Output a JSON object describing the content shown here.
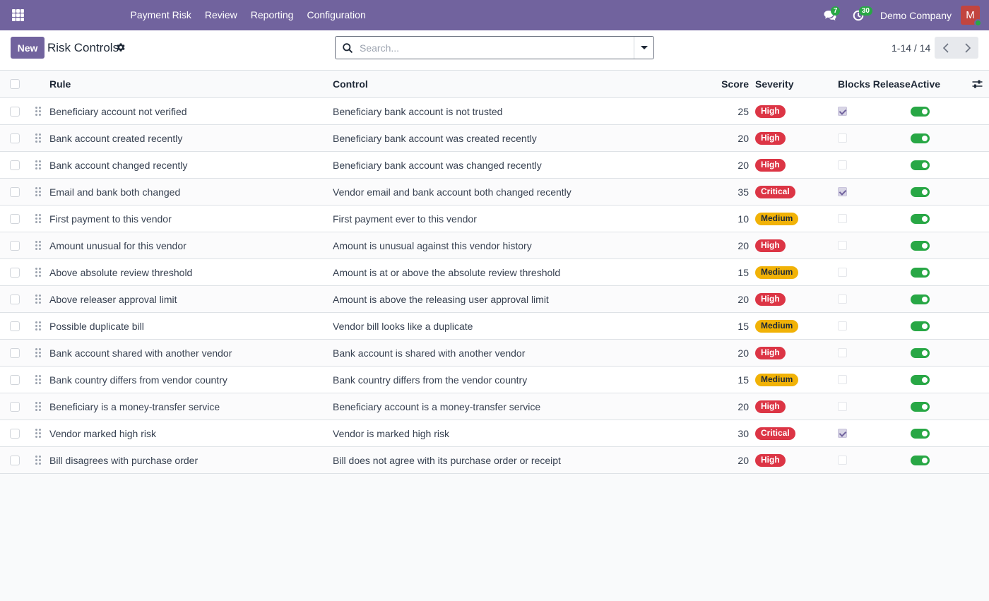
{
  "nav": {
    "menu": [
      "Payment Risk",
      "Review",
      "Reporting",
      "Configuration"
    ],
    "messages_count": "7",
    "activities_count": "30",
    "company": "Demo Company",
    "avatar_letter": "M",
    "brand_color": "#71639e"
  },
  "control_panel": {
    "new_label": "New",
    "title": "Risk Controls",
    "search_placeholder": "Search...",
    "pager": "1-14 / 14"
  },
  "table": {
    "columns": {
      "rule": "Rule",
      "control": "Control",
      "score": "Score",
      "severity": "Severity",
      "blocks_release": "Blocks Release",
      "active": "Active"
    },
    "severity_colors": {
      "High": "#dc3545",
      "Critical": "#dc3545",
      "Medium": "#f1b207"
    },
    "rows": [
      {
        "rule": "Beneficiary account not verified",
        "control": "Beneficiary bank account is not trusted",
        "score": "25",
        "severity": "High",
        "blocks_release": true,
        "active": true
      },
      {
        "rule": "Bank account created recently",
        "control": "Beneficiary bank account was created recently",
        "score": "20",
        "severity": "High",
        "blocks_release": false,
        "active": true
      },
      {
        "rule": "Bank account changed recently",
        "control": "Beneficiary bank account was changed recently",
        "score": "20",
        "severity": "High",
        "blocks_release": false,
        "active": true
      },
      {
        "rule": "Email and bank both changed",
        "control": "Vendor email and bank account both changed recently",
        "score": "35",
        "severity": "Critical",
        "blocks_release": true,
        "active": true
      },
      {
        "rule": "First payment to this vendor",
        "control": "First payment ever to this vendor",
        "score": "10",
        "severity": "Medium",
        "blocks_release": false,
        "active": true
      },
      {
        "rule": "Amount unusual for this vendor",
        "control": "Amount is unusual against this vendor history",
        "score": "20",
        "severity": "High",
        "blocks_release": false,
        "active": true
      },
      {
        "rule": "Above absolute review threshold",
        "control": "Amount is at or above the absolute review threshold",
        "score": "15",
        "severity": "Medium",
        "blocks_release": false,
        "active": true
      },
      {
        "rule": "Above releaser approval limit",
        "control": "Amount is above the releasing user approval limit",
        "score": "20",
        "severity": "High",
        "blocks_release": false,
        "active": true
      },
      {
        "rule": "Possible duplicate bill",
        "control": "Vendor bill looks like a duplicate",
        "score": "15",
        "severity": "Medium",
        "blocks_release": false,
        "active": true
      },
      {
        "rule": "Bank account shared with another vendor",
        "control": "Bank account is shared with another vendor",
        "score": "20",
        "severity": "High",
        "blocks_release": false,
        "active": true
      },
      {
        "rule": "Bank country differs from vendor country",
        "control": "Bank country differs from the vendor country",
        "score": "15",
        "severity": "Medium",
        "blocks_release": false,
        "active": true
      },
      {
        "rule": "Beneficiary is a money-transfer service",
        "control": "Beneficiary account is a money-transfer service",
        "score": "20",
        "severity": "High",
        "blocks_release": false,
        "active": true
      },
      {
        "rule": "Vendor marked high risk",
        "control": "Vendor is marked high risk",
        "score": "30",
        "severity": "Critical",
        "blocks_release": true,
        "active": true
      },
      {
        "rule": "Bill disagrees with purchase order",
        "control": "Bill does not agree with its purchase order or receipt",
        "score": "20",
        "severity": "High",
        "blocks_release": false,
        "active": true
      }
    ]
  }
}
